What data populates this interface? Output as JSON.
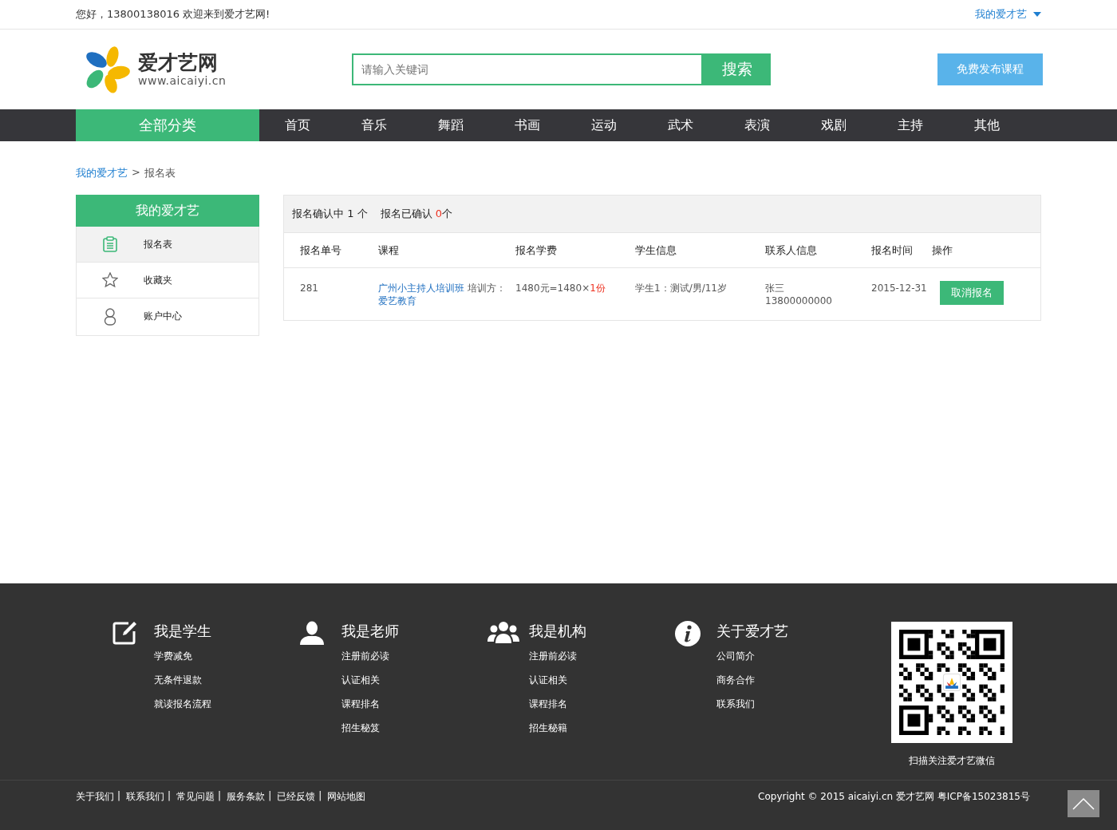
{
  "topbar": {
    "greeting": "您好，13800138016 欢迎来到爱才艺网!",
    "account_menu": "我的爱才艺"
  },
  "logo": {
    "name": "爱才艺网",
    "url": "www.aicaiyi.cn"
  },
  "search": {
    "placeholder": "请输入关键词",
    "button": "搜索"
  },
  "publish_button": "免费发布课程",
  "nav": {
    "category": "全部分类",
    "items": [
      {
        "label": "首页",
        "selected": false
      },
      {
        "label": "音乐",
        "selected": false
      },
      {
        "label": "舞蹈",
        "selected": false
      },
      {
        "label": "书画",
        "selected": false
      },
      {
        "label": "运动",
        "selected": false
      },
      {
        "label": "武术",
        "selected": false
      },
      {
        "label": "表演",
        "selected": false
      },
      {
        "label": "戏剧",
        "selected": false
      },
      {
        "label": "主持",
        "selected": false
      },
      {
        "label": "其他",
        "selected": false
      }
    ]
  },
  "breadcrumb": {
    "link": "我的爱才艺",
    "separator": ">",
    "current": "报名表"
  },
  "sidebar": {
    "title": "我的爱才艺",
    "items": [
      {
        "label": "报名表",
        "kind": "form",
        "selected": true
      },
      {
        "label": "收藏夹",
        "kind": "star",
        "selected": false
      },
      {
        "label": "账户中心",
        "kind": "user",
        "selected": false
      }
    ]
  },
  "summary": {
    "pending_label": "报名确认中",
    "pending_count": "1 个",
    "confirmed_label": "报名已确认",
    "confirmed_count": "0",
    "confirmed_unit": "个"
  },
  "table": {
    "columns": [
      "报名单号",
      "课程",
      "报名学费",
      "学生信息",
      "联系人信息",
      "报名时间",
      "操作"
    ],
    "rows": [
      {
        "id": "281",
        "course": "广州小主持人培训班",
        "provider_label": "培训方：",
        "provider": "爱艺教育",
        "fee": "1480元=1480×",
        "quantity": "1份",
        "student": "学生1：测试/男/11岁",
        "contact_name": "张三",
        "contact_phone": "13800000000",
        "date": "2015-12-31",
        "action": "取消报名"
      }
    ]
  },
  "footer": {
    "columns": [
      {
        "kind": "edit",
        "title": "我是学生",
        "links": [
          "学费减免",
          "无条件退款",
          "就读报名流程"
        ]
      },
      {
        "kind": "person",
        "title": "我是老师",
        "links": [
          "注册前必读",
          "认证相关",
          "课程排名",
          "招生秘笈"
        ]
      },
      {
        "kind": "group",
        "title": "我是机构",
        "links": [
          "注册前必读",
          "认证相关",
          "课程排名",
          "招生秘籍"
        ]
      },
      {
        "kind": "info",
        "title": "关于爱才艺",
        "links": [
          "公司简介",
          "商务合作",
          "联系我们"
        ]
      }
    ],
    "qr_caption": "扫描关注爱才艺微信",
    "bottom_links": [
      "关于我们",
      "联系我们",
      "常见问题",
      "服务条款",
      "已经反馈",
      "网站地图"
    ],
    "link_separator": "|",
    "copyright": "Copyright © 2015 aicaiyi.cn 爱才艺网 粤ICP备15023815号"
  }
}
